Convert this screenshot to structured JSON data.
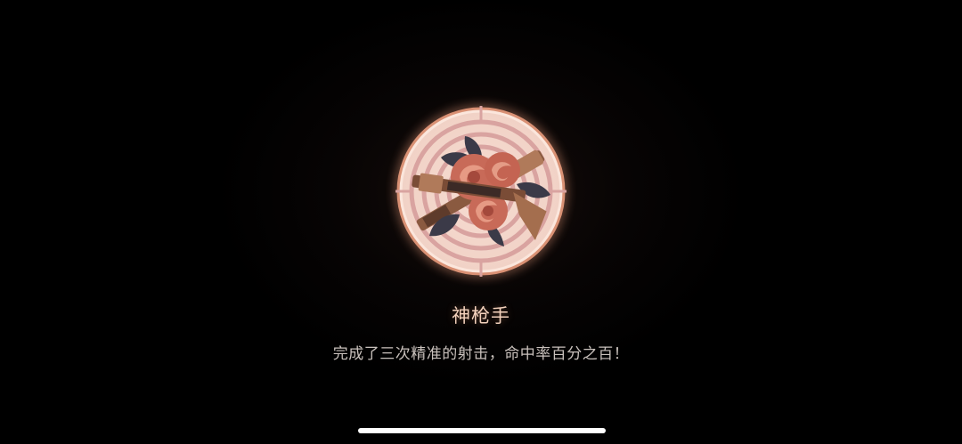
{
  "achievement": {
    "icon": "crossed-rifles-roses-target-icon",
    "title": "神枪手",
    "description": "完成了三次精准的射击，命中率百分之百！"
  },
  "colors": {
    "background": "#000000",
    "badge_glow": "#f0a080",
    "badge_ring": "#f3d6c8",
    "target_stripe": "#d9a3a0",
    "rose": "#c86a58",
    "leaf": "#3b3a48",
    "rifle_wood": "#8a5a40",
    "title_text": "#f4d2bd",
    "description_text": "#c9c1bc"
  },
  "system": {
    "home_indicator": "home-indicator-bar"
  }
}
